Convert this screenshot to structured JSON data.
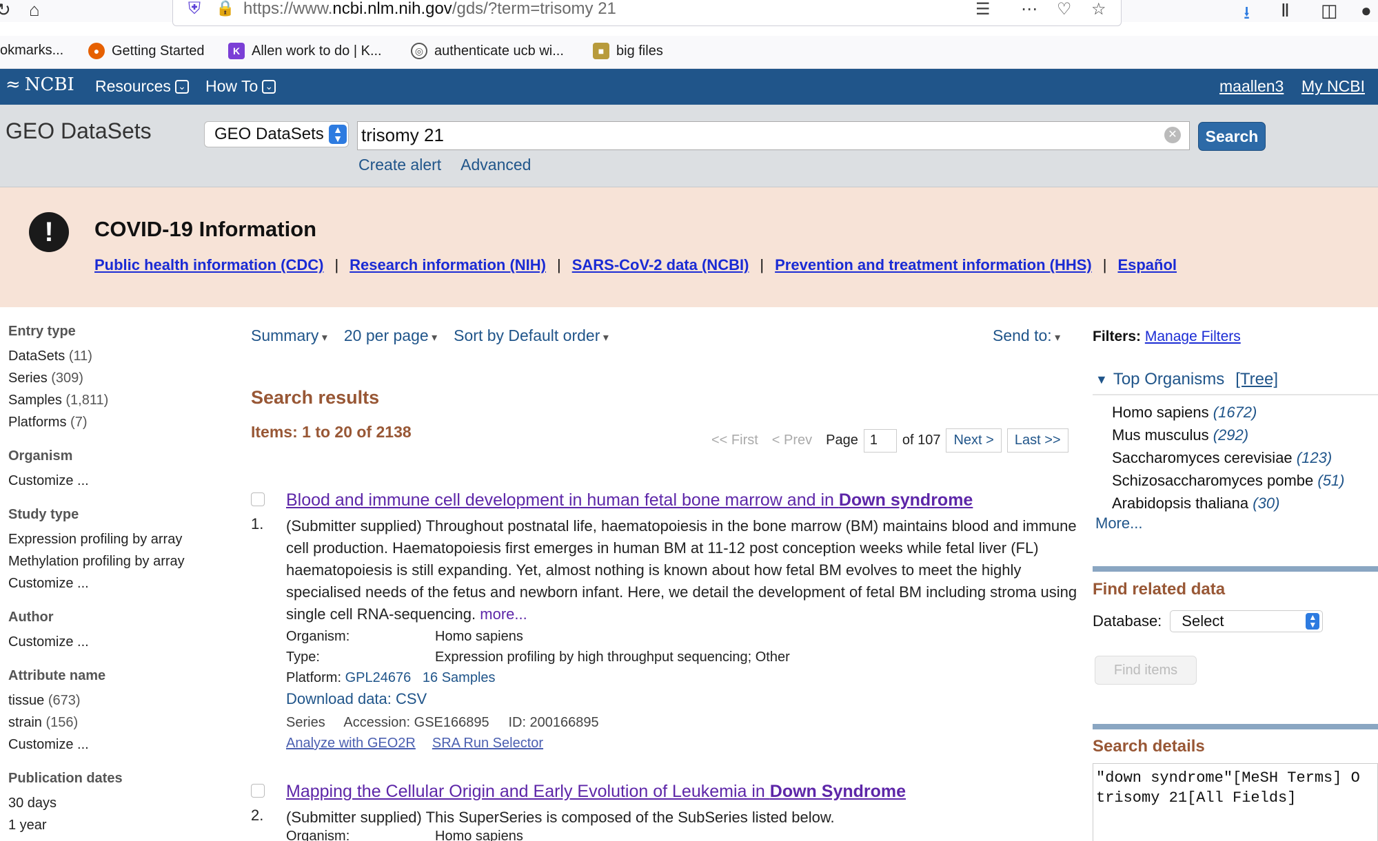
{
  "browser": {
    "url_prefix": "https://www.",
    "url_domain": "ncbi.nlm.nih.gov",
    "url_rest": "/gds/?term=trisomy 21",
    "bookmarks": [
      {
        "label": "okmarks...",
        "icon": "none"
      },
      {
        "label": "Getting Started",
        "icon": "firefox-icon",
        "color": "#e66000"
      },
      {
        "label": "Allen work to do | K...",
        "icon": "k-icon",
        "color": "#7b3fd6"
      },
      {
        "label": "authenticate ucb wi...",
        "icon": "globe-icon",
        "color": "#555555"
      },
      {
        "label": "big files",
        "icon": "folder-icon",
        "color": "#b89b3c"
      }
    ]
  },
  "ncbi": {
    "logo": "NCBI",
    "menu": [
      "Resources",
      "How To"
    ],
    "user": "maallen3",
    "my_ncbi": "My NCBI"
  },
  "search": {
    "db_title": "GEO DataSets",
    "db_select": "GEO DataSets",
    "query": "trisomy 21",
    "button": "Search",
    "links": [
      "Create alert",
      "Advanced"
    ]
  },
  "covid": {
    "title": "COVID-19 Information",
    "links": [
      "Public health information (CDC)",
      "Research information (NIH)",
      "SARS-CoV-2 data (NCBI)",
      "Prevention and treatment information (HHS)",
      "Español"
    ],
    "sep": "|"
  },
  "facets": [
    {
      "head": "Entry type",
      "items": [
        {
          "label": "DataSets",
          "count": "(11)"
        },
        {
          "label": "Series",
          "count": "(309)"
        },
        {
          "label": "Samples",
          "count": "(1,811)"
        },
        {
          "label": "Platforms",
          "count": "(7)"
        }
      ]
    },
    {
      "head": "Organism",
      "items": [
        {
          "label": "Customize ...",
          "count": ""
        }
      ]
    },
    {
      "head": "Study type",
      "items": [
        {
          "label": "Expression profiling by array",
          "count": ""
        },
        {
          "label": "Methylation profiling by array",
          "count": ""
        },
        {
          "label": "Customize ...",
          "count": ""
        }
      ]
    },
    {
      "head": "Author",
      "items": [
        {
          "label": "Customize ...",
          "count": ""
        }
      ]
    },
    {
      "head": "Attribute name",
      "items": [
        {
          "label": "tissue",
          "count": "(673)"
        },
        {
          "label": "strain",
          "count": "(156)"
        },
        {
          "label": "Customize ...",
          "count": ""
        }
      ]
    },
    {
      "head": "Publication dates",
      "items": [
        {
          "label": "30 days",
          "count": ""
        },
        {
          "label": "1 year",
          "count": ""
        }
      ]
    }
  ],
  "toolbar": {
    "summary": "Summary",
    "per_page": "20 per page",
    "sort": "Sort by Default order",
    "send_to": "Send to:"
  },
  "results": {
    "title": "Search results",
    "items": "Items: 1 to 20 of 2138",
    "pager": {
      "first": "<< First",
      "prev": "< Prev",
      "page_label": "Page",
      "page": "1",
      "of": "of 107",
      "next": "Next >",
      "last": "Last >>"
    },
    "list": [
      {
        "num": "1.",
        "title_pre": "Blood and immune cell development in human fetal bone marrow and in ",
        "title_bold": "Down syndrome",
        "summary": "(Submitter supplied) Throughout postnatal life, haematopoiesis in the bone marrow (BM) maintains blood and immune cell production. Haematopoiesis first emerges in human BM at 11-12 post conception weeks while fetal liver (FL) haematopoiesis is still expanding. Yet, almost nothing is known about how fetal BM evolves to meet the highly specialised needs of the fetus and newborn infant. Here, we detail the development of fetal BM including stroma using single cell RNA-sequencing. ",
        "more": "more...",
        "organism_label": "Organism:",
        "organism": "Homo sapiens",
        "type_label": "Type:",
        "type": "Expression profiling by high throughput sequencing; Other",
        "platform_label": "Platform:",
        "platform": "GPL24676",
        "samples": "16 Samples",
        "download": "Download data: CSV",
        "series": "Series",
        "accession": "Accession: GSE166895",
        "id": "ID: 200166895",
        "tool1": "Analyze with GEO2R",
        "tool2": "SRA Run Selector"
      },
      {
        "num": "2.",
        "title_pre": "Mapping the Cellular Origin and Early Evolution of Leukemia in ",
        "title_bold": "Down Syndrome",
        "summary": "(Submitter supplied) This SuperSeries is composed of the SubSeries listed below.",
        "organism_label": "Organism:",
        "organism": "Homo sapiens"
      }
    ]
  },
  "right": {
    "filters_label": "Filters:",
    "manage": "Manage Filters",
    "top_org": "Top Organisms",
    "tree": "[Tree]",
    "organisms": [
      {
        "name": "Homo sapiens",
        "count": "(1672)"
      },
      {
        "name": "Mus musculus",
        "count": "(292)"
      },
      {
        "name": "Saccharomyces cerevisiae",
        "count": "(123)"
      },
      {
        "name": "Schizosaccharomyces pombe",
        "count": "(51)"
      },
      {
        "name": "Arabidopsis thaliana",
        "count": "(30)"
      }
    ],
    "more": "More...",
    "related_title": "Find related data",
    "db_label": "Database:",
    "db_select": "Select",
    "find": "Find items",
    "details_title": "Search details",
    "details": "\"down syndrome\"[MeSH Terms] O\ntrisomy 21[All Fields]"
  }
}
